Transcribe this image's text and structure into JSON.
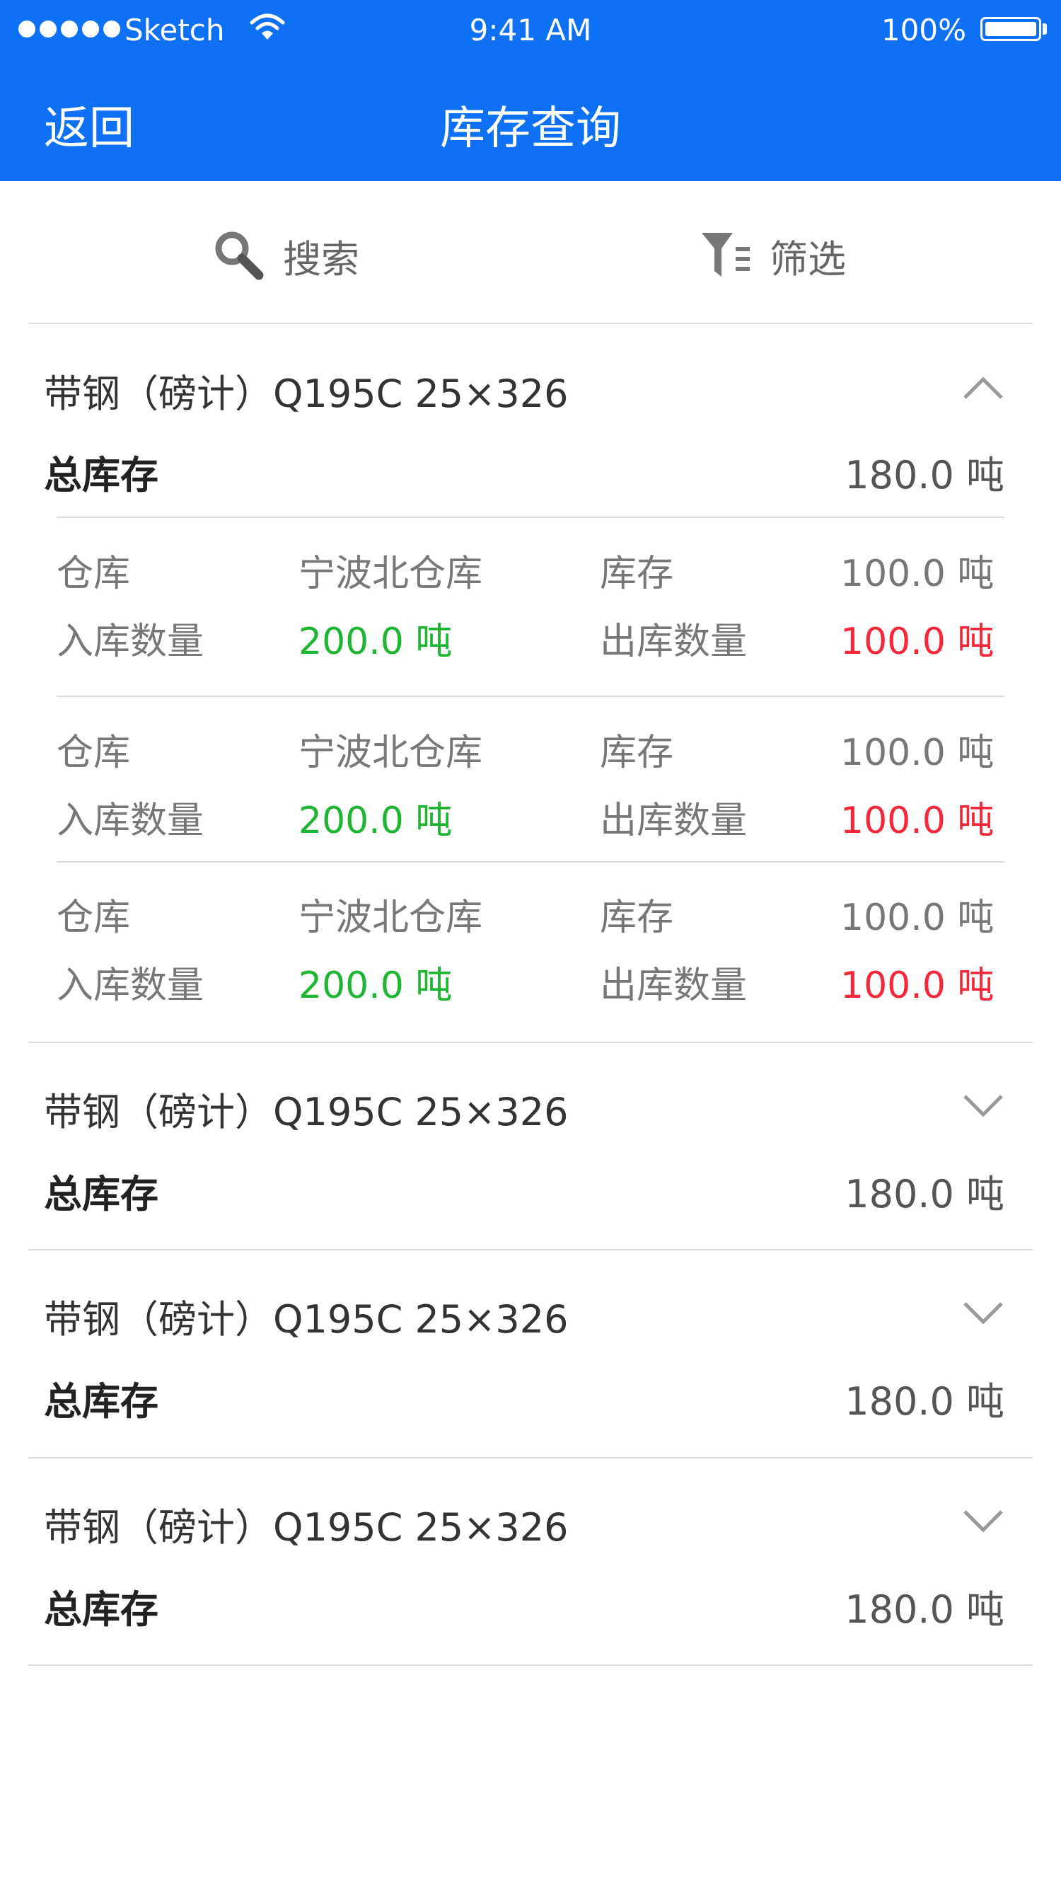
{
  "status_bar": {
    "carrier": "Sketch",
    "time": "9:41 AM",
    "battery": "100%"
  },
  "nav": {
    "back_label": "返回",
    "title": "库存查询"
  },
  "toolbar": {
    "search_label": "搜索",
    "filter_label": "筛选"
  },
  "colors": {
    "nav_bg": "#0e71f5",
    "in_qty": "#1db532",
    "out_qty": "#f5283a"
  },
  "groups": [
    {
      "title": "带钢（磅计）Q195C 25×326",
      "expanded": true,
      "total_label": "总库存",
      "total_value": "180.0 吨",
      "details": [
        {
          "warehouse_label": "仓库",
          "warehouse": "宁波北仓库",
          "stock_label": "库存",
          "stock": "100.0 吨",
          "in_label": "入库数量",
          "in_qty": "200.0 吨",
          "out_label": "出库数量",
          "out_qty": "100.0 吨"
        },
        {
          "warehouse_label": "仓库",
          "warehouse": "宁波北仓库",
          "stock_label": "库存",
          "stock": "100.0 吨",
          "in_label": "入库数量",
          "in_qty": "200.0 吨",
          "out_label": "出库数量",
          "out_qty": "100.0 吨"
        },
        {
          "warehouse_label": "仓库",
          "warehouse": "宁波北仓库",
          "stock_label": "库存",
          "stock": "100.0 吨",
          "in_label": "入库数量",
          "in_qty": "200.0 吨",
          "out_label": "出库数量",
          "out_qty": "100.0 吨"
        }
      ]
    },
    {
      "title": "带钢（磅计）Q195C 25×326",
      "expanded": false,
      "total_label": "总库存",
      "total_value": "180.0 吨"
    },
    {
      "title": "带钢（磅计）Q195C 25×326",
      "expanded": false,
      "total_label": "总库存",
      "total_value": "180.0 吨"
    },
    {
      "title": "带钢（磅计）Q195C 25×326",
      "expanded": false,
      "total_label": "总库存",
      "total_value": "180.0 吨"
    }
  ]
}
